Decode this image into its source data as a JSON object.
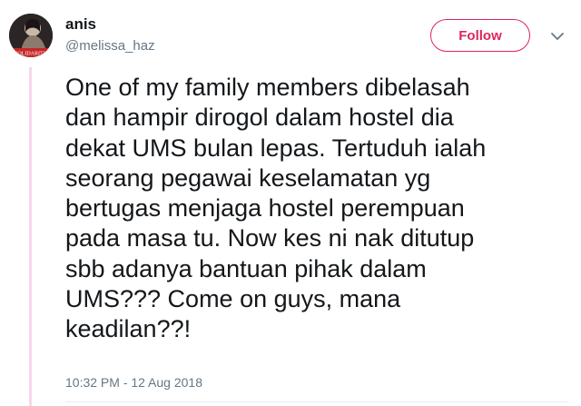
{
  "tweet": {
    "author_name": "anis",
    "author_handle": "@melissa_haz",
    "avatar_badge_text": "SOLIDARITY",
    "follow_label": "Follow",
    "text": "One of my family members dibelasah\ndan hampir dirogol dalam hostel dia\ndekat UMS bulan lepas. Tertuduh ialah\nseorang pegawai keselamatan yg\nbertugas menjaga hostel perempuan\npada masa tu. Now kes ni nak ditutup\nsbb adanya bantuan pihak dalam\nUMS??? Come on guys, mana\nkeadilan??!",
    "timestamp": "10:32 PM - 12 Aug 2018"
  },
  "colors": {
    "accent": "#e0245e",
    "text_primary": "#14171a",
    "text_secondary": "#657786",
    "thread_line": "#f8d7ea"
  },
  "icons": {
    "more_options": "chevron-down-icon"
  }
}
